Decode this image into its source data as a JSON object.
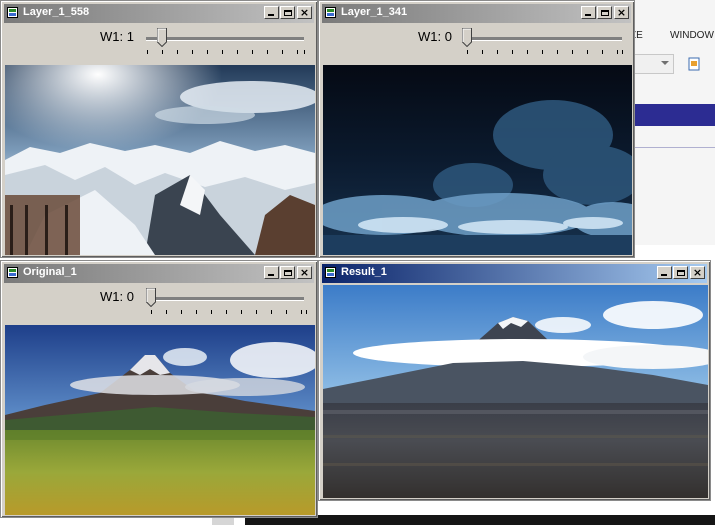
{
  "background_app": {
    "menu_items": [
      "ZE",
      "WINDOW"
    ]
  },
  "windows": [
    {
      "id": "layer_558",
      "title": "Layer_1_558",
      "slider_label": "W1: 1",
      "slider_value": 1,
      "active": false
    },
    {
      "id": "layer_341",
      "title": "Layer_1_341",
      "slider_label": "W1: 0",
      "slider_value": 0,
      "active": false
    },
    {
      "id": "original",
      "title": "Original_1",
      "slider_label": "W1: 0",
      "slider_value": 0,
      "active": false
    },
    {
      "id": "result",
      "title": "Result_1",
      "active": true
    }
  ],
  "title_buttons": [
    "minimize-icon",
    "maximize-icon",
    "close-icon"
  ],
  "colors": {
    "title_active_left": "#0b246a",
    "title_active_right": "#a6caf0",
    "title_inactive_left": "#7a7a7a",
    "title_inactive_right": "#c2c2c2",
    "window_face": "#d4d0c8"
  }
}
